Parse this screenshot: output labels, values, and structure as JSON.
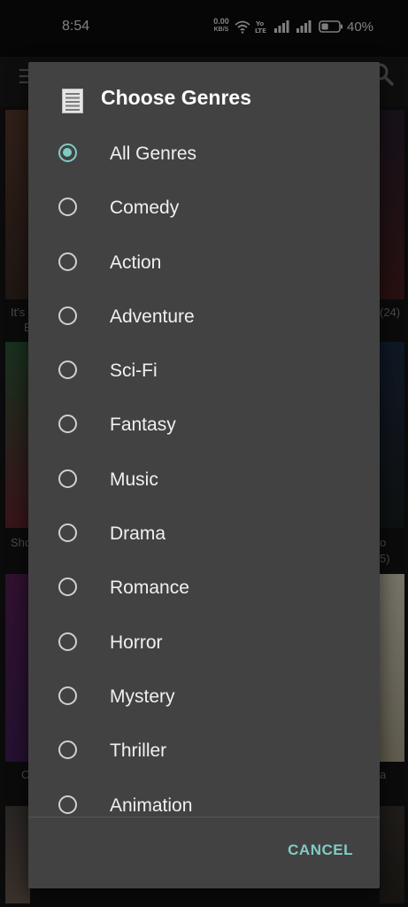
{
  "status_bar": {
    "time": "8:54",
    "net_speed_value": "0.00",
    "net_speed_unit": "KB/S",
    "battery_percent": "40%",
    "icons": [
      "wifi-icon",
      "volte-icon",
      "signal-icon",
      "signal-icon",
      "battery-icon"
    ]
  },
  "background": {
    "captions": [
      "It's",
      "E",
      "(24)",
      "Sho",
      "o",
      "5)",
      "C",
      "a"
    ]
  },
  "dialog": {
    "title": "Choose Genres",
    "icon": "list-document-icon",
    "options": [
      {
        "label": "All Genres",
        "selected": true
      },
      {
        "label": "Comedy",
        "selected": false
      },
      {
        "label": "Action",
        "selected": false
      },
      {
        "label": "Adventure",
        "selected": false
      },
      {
        "label": "Sci-Fi",
        "selected": false
      },
      {
        "label": "Fantasy",
        "selected": false
      },
      {
        "label": "Music",
        "selected": false
      },
      {
        "label": "Drama",
        "selected": false
      },
      {
        "label": "Romance",
        "selected": false
      },
      {
        "label": "Horror",
        "selected": false
      },
      {
        "label": "Mystery",
        "selected": false
      },
      {
        "label": "Thriller",
        "selected": false
      },
      {
        "label": "Animation",
        "selected": false
      }
    ],
    "cancel_label": "CANCEL"
  },
  "colors": {
    "dialog_bg": "#424242",
    "accent": "#80cbc4",
    "text": "#f0f0f0"
  }
}
